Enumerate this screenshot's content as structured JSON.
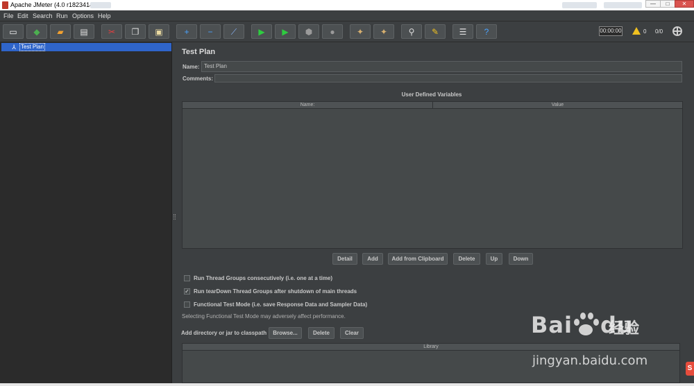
{
  "window": {
    "title": "Apache JMeter (4.0 r1823414)",
    "minimize": "—",
    "maximize": "□",
    "close": "✕"
  },
  "menu": [
    "File",
    "Edit",
    "Search",
    "Run",
    "Options",
    "Help"
  ],
  "toolbar": {
    "buttons": [
      {
        "name": "new-icon",
        "glyph": "▭",
        "color": "#f5f5f5"
      },
      {
        "name": "templates-icon",
        "glyph": "◆",
        "color": "#4caf50"
      },
      {
        "name": "open-icon",
        "glyph": "▰",
        "color": "#f0a030"
      },
      {
        "name": "save-icon",
        "glyph": "▤",
        "color": "#e0e0e0"
      },
      {
        "name": "cut-icon",
        "glyph": "✂",
        "color": "#e04040"
      },
      {
        "name": "copy-icon",
        "glyph": "❐",
        "color": "#e0e0e0"
      },
      {
        "name": "paste-icon",
        "glyph": "▣",
        "color": "#e8d8a0"
      },
      {
        "name": "expand-icon",
        "glyph": "+",
        "color": "#4aa3ff"
      },
      {
        "name": "collapse-icon",
        "glyph": "−",
        "color": "#4aa3ff"
      },
      {
        "name": "toggle-icon",
        "glyph": "⟋",
        "color": "#8ab4f8"
      },
      {
        "name": "start-icon",
        "glyph": "▶",
        "color": "#2ecc40"
      },
      {
        "name": "start-no-pauses-icon",
        "glyph": "▶",
        "color": "#2ecc40"
      },
      {
        "name": "stop-icon",
        "glyph": "⬢",
        "color": "#9a9a9a"
      },
      {
        "name": "shutdown-icon",
        "glyph": "●",
        "color": "#9a9a9a"
      },
      {
        "name": "clear-icon",
        "glyph": "✦",
        "color": "#d8b070"
      },
      {
        "name": "clear-all-icon",
        "glyph": "✦",
        "color": "#d8b070"
      },
      {
        "name": "search-icon",
        "glyph": "⚲",
        "color": "#dcdcdc"
      },
      {
        "name": "reset-search-icon",
        "glyph": "✎",
        "color": "#f0c020"
      },
      {
        "name": "function-helper-icon",
        "glyph": "☰",
        "color": "#e0e0e0"
      },
      {
        "name": "help-icon",
        "glyph": "?",
        "color": "#4aa3ff"
      }
    ],
    "timer": "00:00:00",
    "warnings": "0",
    "threads": "0/0"
  },
  "tree": {
    "selected_label": "Test Plan"
  },
  "test_plan": {
    "heading": "Test Plan",
    "name_label": "Name:",
    "name_value": "Test Plan",
    "comments_label": "Comments:",
    "udv_title": "User Defined Variables",
    "udv_columns": [
      "Name:",
      "Value"
    ],
    "udv_buttons": [
      "Detail",
      "Add",
      "Add from Clipboard",
      "Delete",
      "Up",
      "Down"
    ],
    "checkboxes": [
      {
        "label": "Run Thread Groups consecutively (i.e. one at a time)",
        "checked": false
      },
      {
        "label": "Run tearDown Thread Groups after shutdown of main threads",
        "checked": true
      },
      {
        "label": "Functional Test Mode (i.e. save Response Data and Sampler Data)",
        "checked": false
      }
    ],
    "functional_note": "Selecting Functional Test Mode may adversely affect performance.",
    "classpath_label": "Add directory or jar to classpath",
    "classpath_buttons": [
      "Browse...",
      "Delete",
      "Clear"
    ],
    "library_column": "Library"
  },
  "watermark": {
    "logo_left": "Bai",
    "logo_right": "du",
    "chinese": "经验",
    "url": "jingyan.baidu.com"
  },
  "corner_badge": "S"
}
